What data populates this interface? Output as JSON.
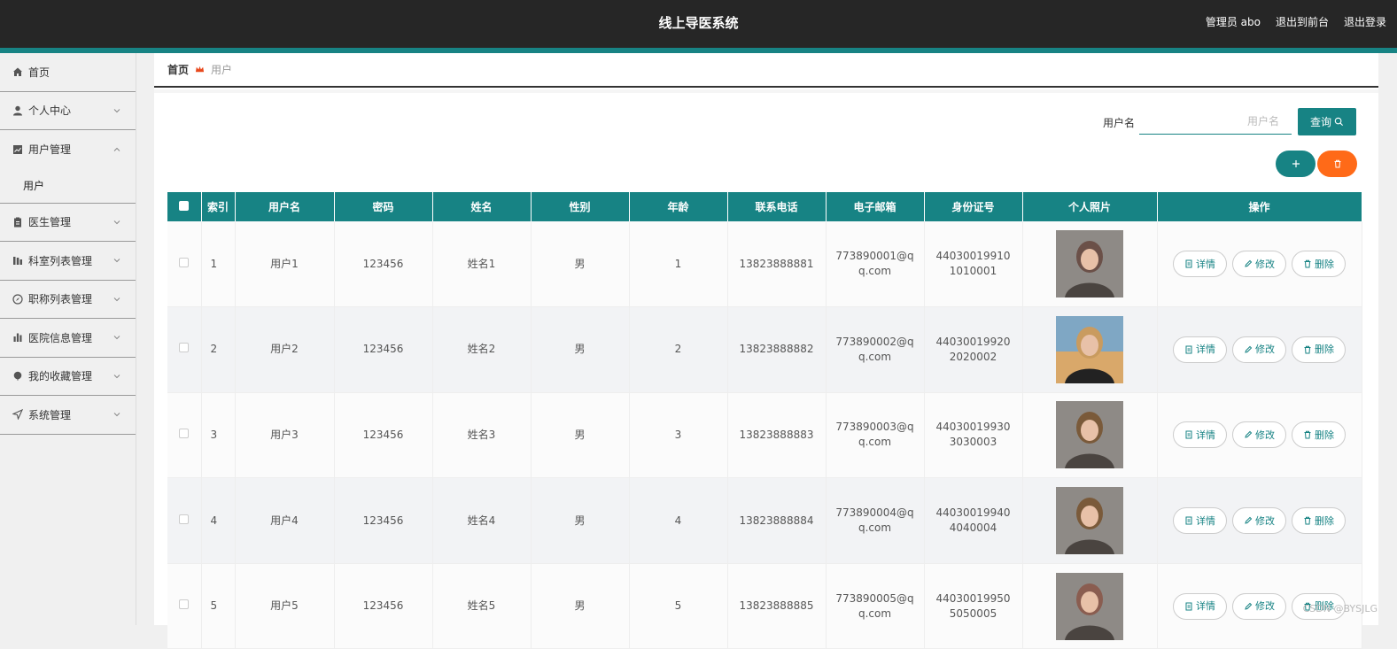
{
  "header": {
    "title": "线上导医系统",
    "links": [
      "管理员 abo",
      "退出到前台",
      "退出登录"
    ]
  },
  "sidebar": {
    "items": [
      {
        "label": "首页",
        "icon": "home-icon",
        "expandable": false
      },
      {
        "label": "个人中心",
        "icon": "user-icon",
        "expandable": true
      },
      {
        "label": "用户管理",
        "icon": "chart-icon",
        "expandable": true,
        "expanded": true,
        "children": [
          "用户"
        ]
      },
      {
        "label": "医生管理",
        "icon": "clipboard-icon",
        "expandable": true
      },
      {
        "label": "科室列表管理",
        "icon": "bars-icon",
        "expandable": true
      },
      {
        "label": "职称列表管理",
        "icon": "compass-icon",
        "expandable": true
      },
      {
        "label": "医院信息管理",
        "icon": "bar-chart-icon",
        "expandable": true
      },
      {
        "label": "我的收藏管理",
        "icon": "star-icon",
        "expandable": true
      },
      {
        "label": "系统管理",
        "icon": "send-icon",
        "expandable": true
      }
    ]
  },
  "breadcrumb": {
    "home": "首页",
    "current": "用户"
  },
  "search": {
    "label": "用户名",
    "placeholder": "用户名",
    "button": "查询"
  },
  "table": {
    "headers": [
      "索引",
      "用户名",
      "密码",
      "姓名",
      "性别",
      "年龄",
      "联系电话",
      "电子邮箱",
      "身份证号",
      "个人照片",
      "操作"
    ],
    "rows": [
      {
        "idx": "1",
        "username": "用户1",
        "password": "123456",
        "name": "姓名1",
        "gender": "男",
        "age": "1",
        "phone": "13823888881",
        "email": "773890001@qq.com",
        "idcard": "440300199101010001",
        "photo_color": "#6b5048"
      },
      {
        "idx": "2",
        "username": "用户2",
        "password": "123456",
        "name": "姓名2",
        "gender": "男",
        "age": "2",
        "phone": "13823888882",
        "email": "773890002@qq.com",
        "idcard": "440300199202020002",
        "photo_color": "#c99b5f"
      },
      {
        "idx": "3",
        "username": "用户3",
        "password": "123456",
        "name": "姓名3",
        "gender": "男",
        "age": "3",
        "phone": "13823888883",
        "email": "773890003@qq.com",
        "idcard": "440300199303030003",
        "photo_color": "#7a5a3a"
      },
      {
        "idx": "4",
        "username": "用户4",
        "password": "123456",
        "name": "姓名4",
        "gender": "男",
        "age": "4",
        "phone": "13823888884",
        "email": "773890004@qq.com",
        "idcard": "440300199404040004",
        "photo_color": "#7a5a3a"
      },
      {
        "idx": "5",
        "username": "用户5",
        "password": "123456",
        "name": "姓名5",
        "gender": "男",
        "age": "5",
        "phone": "13823888885",
        "email": "773890005@qq.com",
        "idcard": "440300199505050005",
        "photo_color": "#8a5d50"
      }
    ],
    "ops": {
      "detail": "详情",
      "edit": "修改",
      "delete": "删除"
    }
  },
  "watermark": "CSDN @BYSJLG",
  "colors": {
    "primary": "#178384",
    "danger": "#ff6a18",
    "topbar": "#262626"
  }
}
